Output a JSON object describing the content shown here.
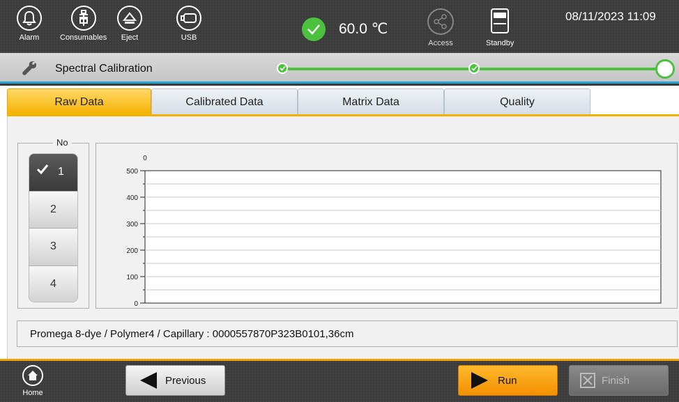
{
  "topbar": {
    "buttons": [
      {
        "label": "Alarm",
        "icon": "bell-icon"
      },
      {
        "label": "Consumables",
        "icon": "consumables-icon"
      },
      {
        "label": "Eject",
        "icon": "eject-icon"
      },
      {
        "label": "USB",
        "icon": "usb-icon"
      }
    ],
    "temperature": "60.0 ℃",
    "access_label": "Access",
    "standby_label": "Standby",
    "datetime": "08/11/2023 11:09"
  },
  "progress": {
    "title": "Spectral Calibration",
    "steps_done": 2,
    "steps_total": 3
  },
  "tabs": [
    {
      "label": "Raw Data",
      "active": true
    },
    {
      "label": "Calibrated Data",
      "active": false
    },
    {
      "label": "Matrix Data",
      "active": false
    },
    {
      "label": "Quality",
      "active": false
    }
  ],
  "capillary_selector": {
    "legend": "No",
    "items": [
      "1",
      "2",
      "3",
      "4"
    ],
    "selected": "1"
  },
  "chart_data": {
    "type": "line",
    "title": "",
    "xlabel": "",
    "ylabel": "",
    "x_tick_labels": [
      "0"
    ],
    "y_tick_labels": [
      "0",
      "100",
      "200",
      "300",
      "400",
      "500"
    ],
    "ylim": [
      0,
      500
    ],
    "grid": true,
    "series": []
  },
  "info": "Promega 8-dye / Polymer4 /  Capillary : 0000557870P323B0101,36cm",
  "bottom": {
    "home_label": "Home",
    "previous_label": "Previous",
    "run_label": "Run",
    "finish_label": "Finish"
  },
  "colors": {
    "accent_orange": "#f4b200",
    "success_green": "#4cc13e",
    "progress_blue": "#23a3d6"
  }
}
